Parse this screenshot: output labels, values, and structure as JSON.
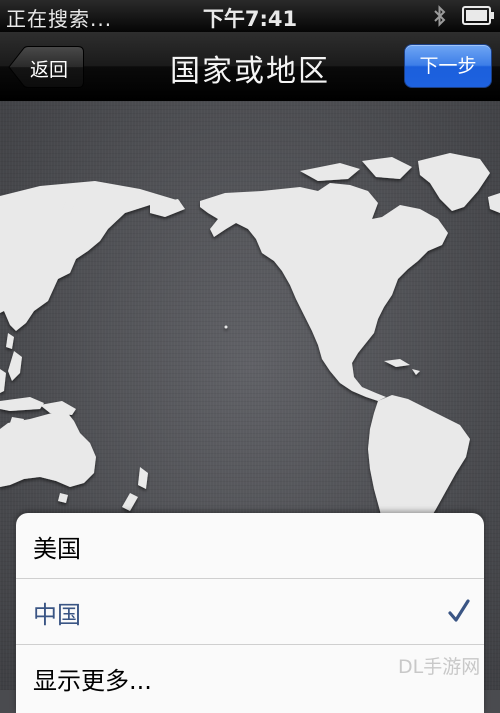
{
  "status_bar": {
    "carrier": "正在搜索...",
    "time": "下午7:41"
  },
  "nav_bar": {
    "back_label": "返回",
    "title": "国家或地区",
    "next_label": "下一步"
  },
  "country_list": {
    "items": [
      {
        "label": "美国",
        "selected": false
      },
      {
        "label": "中国",
        "selected": true
      },
      {
        "label": "显示更多..."
      }
    ]
  },
  "watermark": "DL手游网",
  "colors": {
    "accent_blue": "#1e62e0",
    "selected_text": "#3a5584",
    "nav_bg": "#1a1a1a",
    "map_bg": "#55565a"
  },
  "icons": [
    "bluetooth-icon",
    "battery-icon",
    "checkmark-icon"
  ]
}
